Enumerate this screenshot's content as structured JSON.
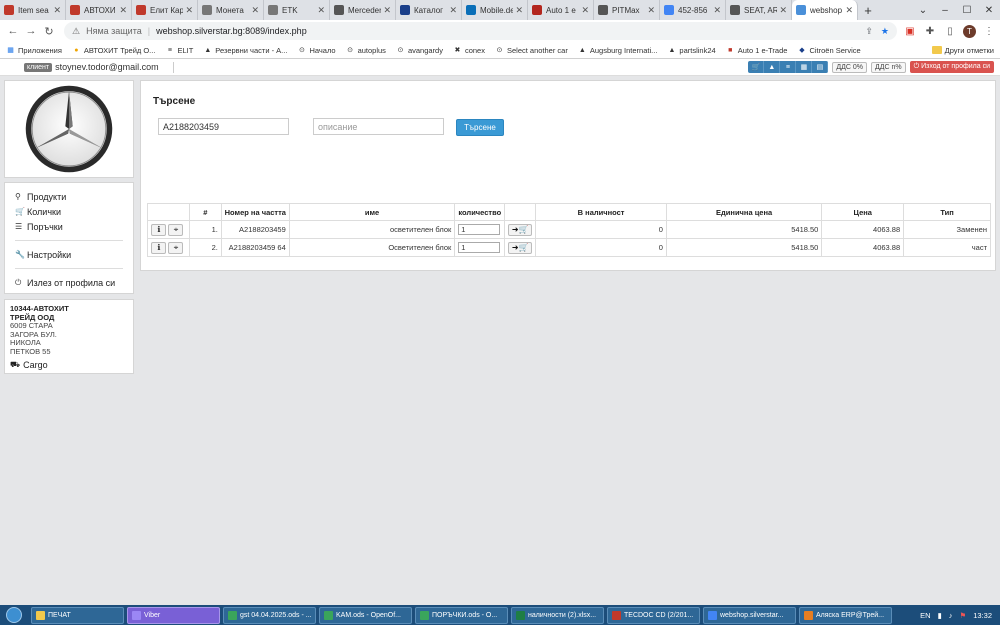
{
  "browser": {
    "tabs": [
      {
        "title": "Item sea",
        "color": "#c0392b",
        "active": false
      },
      {
        "title": "АВТОХИ",
        "color": "#c0392b",
        "active": false
      },
      {
        "title": "Елит Кар",
        "color": "#c0392b",
        "active": false
      },
      {
        "title": "Монета",
        "color": "#777777",
        "active": false
      },
      {
        "title": "ETK",
        "color": "#777777",
        "active": false
      },
      {
        "title": "Merceder",
        "color": "#555555",
        "active": false
      },
      {
        "title": "Каталог",
        "color": "#1a3f8a",
        "active": false
      },
      {
        "title": "Mobile.de",
        "color": "#0a6fb8",
        "active": false
      },
      {
        "title": "Auto 1 e",
        "color": "#b3261e",
        "active": false
      },
      {
        "title": "PITMax",
        "color": "#555555",
        "active": false
      },
      {
        "title": "452-856",
        "color": "#4285f4",
        "active": false
      },
      {
        "title": "SEAT, AR",
        "color": "#555555",
        "active": false
      },
      {
        "title": "webshop",
        "color": "#4a90d9",
        "active": true
      }
    ],
    "new_tab": "+",
    "address": {
      "warning": "Няма защита",
      "url": "webshop.silverstar.bg:8089/index.php"
    },
    "profile_initial": "T",
    "bookmarks": [
      {
        "label": "Приложения",
        "icon": "apps-grid-icon"
      },
      {
        "label": "АВТОХИТ Трейд О...",
        "icon": "bookmark-autohit-icon"
      },
      {
        "label": "ELIT",
        "icon": "bookmark-elit-icon"
      },
      {
        "label": "Резервни части - А...",
        "icon": "bookmark-parts-icon"
      },
      {
        "label": "Начало",
        "icon": "bookmark-start-icon"
      },
      {
        "label": "autoplus",
        "icon": "bookmark-autoplus-icon"
      },
      {
        "label": "avangardy",
        "icon": "bookmark-avangardy-icon"
      },
      {
        "label": "conex",
        "icon": "bookmark-conex-icon"
      },
      {
        "label": "Select another car",
        "icon": "bookmark-car-icon"
      },
      {
        "label": "Augsburg Internati...",
        "icon": "bookmark-augsburg-icon"
      },
      {
        "label": "partslink24",
        "icon": "bookmark-partslink-icon"
      },
      {
        "label": "Auto 1 e-Trade",
        "icon": "bookmark-auto1-icon"
      },
      {
        "label": "Citroën Service",
        "icon": "bookmark-citroen-icon"
      }
    ],
    "other_bookmarks": "Други отметки"
  },
  "header": {
    "client_badge": "клиент",
    "email": "stoynev.todor@gmail.com",
    "vat_off": "ДДС 0%",
    "vat_on": "ДДС n%",
    "logout": "Изход от профила си"
  },
  "sidebar": {
    "menu": [
      {
        "label": "Продукти",
        "icon": "search-icon",
        "glyph": "⚲"
      },
      {
        "label": "Колички",
        "icon": "cart-icon",
        "glyph": "🛒"
      },
      {
        "label": "Поръчки",
        "icon": "list-icon",
        "glyph": "☰"
      }
    ],
    "settings": {
      "label": "Настройки",
      "icon": "wrench-icon",
      "glyph": "🔧"
    },
    "logout": {
      "label": "Излез от профила си",
      "icon": "power-icon",
      "glyph": "⏻"
    },
    "address": {
      "company_line1": "10344-АВТОХИТ",
      "company_line2": "ТРЕЙД ООД",
      "line1": "6009 СТАРА",
      "line2": "ЗАГОРА БУЛ.",
      "line3": "НИКОЛА",
      "line4": "ПЕТКОВ 55",
      "courier": "Cargo"
    }
  },
  "search": {
    "title": "Търсене",
    "part_number_value": "A2188203459",
    "description_placeholder": "описание",
    "button": "Търсене"
  },
  "results": {
    "columns": [
      "",
      "#",
      "Номер на частта",
      "име",
      "количество",
      "",
      "В наличност",
      "Единична цена",
      "Цена",
      "Тип"
    ],
    "rows": [
      {
        "num": "1.",
        "part": "A2188203459",
        "name": "осветителен блок",
        "qty": "1",
        "stock": "0",
        "unit_price": "5418.50",
        "price": "4063.88",
        "type": "Заменен"
      },
      {
        "num": "2.",
        "part": "A2188203459 64",
        "name": "Осветителен блок",
        "qty": "1",
        "stock": "0",
        "unit_price": "5418.50",
        "price": "4063.88",
        "type": "част"
      }
    ]
  },
  "taskbar": {
    "apps": [
      {
        "label": "ПЕЧАТ"
      },
      {
        "label": "Viber"
      },
      {
        "label": "gst 04.04.2025.ods - ..."
      },
      {
        "label": "KAM.ods - OpenOf..."
      },
      {
        "label": "ПОРЪЧКИ.ods - O..."
      },
      {
        "label": "наличности (2).xlsx..."
      },
      {
        "label": "TECDOC CD (2/201..."
      },
      {
        "label": "webshop.silverstar..."
      },
      {
        "label": "Аляска ERP@Трей..."
      }
    ],
    "lang": "EN",
    "time": "13:32"
  },
  "colors": {
    "accent": "#3a9ad5",
    "logout_red": "#d9534f",
    "taskbar": "#1c4d7a"
  }
}
